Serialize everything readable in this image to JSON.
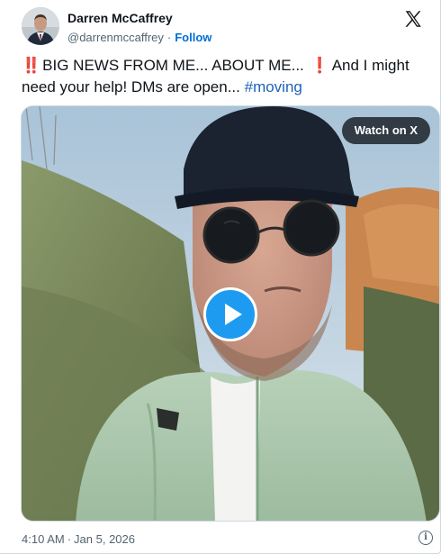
{
  "author": {
    "name": "Darren McCaffrey",
    "handle": "@darrenmccaffrey",
    "separator": "·",
    "follow_label": "Follow"
  },
  "tweet": {
    "text_main": "BIG NEWS FROM ME... ABOUT ME...",
    "text_after": "And I might need your help! DMs are open...",
    "hashtag": "#moving",
    "emoji_1": "‼️",
    "emoji_2": "❗"
  },
  "media": {
    "watch_label": "Watch on X",
    "play_icon": "play-icon"
  },
  "footer": {
    "time": "4:10 AM",
    "separator": "·",
    "date": "Jan 5, 2026",
    "info_icon": "info-icon"
  },
  "colors": {
    "link_blue": "#006fd6",
    "hashtag_blue": "#1d63b8",
    "play_blue": "#1d9bf0",
    "emoji_red": "#d81e1e",
    "text": "#0f1419",
    "muted": "#536471"
  }
}
